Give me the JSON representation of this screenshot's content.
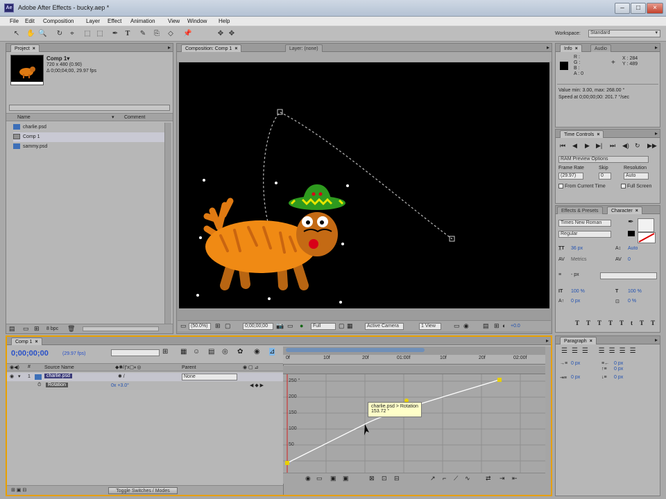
{
  "app": {
    "window_title": "Adobe After Effects - bucky.aep *",
    "icon_label": "Ae"
  },
  "window_controls": {
    "minimize": "–",
    "maximize": "□",
    "close": "×"
  },
  "menu": [
    "File",
    "Edit",
    "Composition",
    "Layer",
    "Effect",
    "Animation",
    "View",
    "Window",
    "Help"
  ],
  "toolbar": {
    "tools": [
      "↖",
      "✋",
      "🔍",
      "↻",
      "⌖",
      "⬚",
      "✒",
      "T",
      "✎",
      "⎘",
      "◇",
      "📌",
      "✥"
    ],
    "workspace_label": "Workspace:",
    "workspace_value": "Standard"
  },
  "project": {
    "tab": "Project",
    "comp_name": "Comp 1▾",
    "comp_size": "720 x 480 (0.90)",
    "comp_duration": "Δ 0;00;04;00, 29.97 fps",
    "col_name": "Name",
    "col_comment": "Comment",
    "items": [
      {
        "name": "charlie.psd",
        "type": "psd"
      },
      {
        "name": "Comp 1",
        "type": "comp"
      },
      {
        "name": "sammy.psd",
        "type": "psd"
      }
    ],
    "bpc": "8 bpc"
  },
  "composition_panel": {
    "tab1": "Composition: Comp 1",
    "tab2": "Layer: (none)",
    "zoom": "(50.0%)",
    "time": "0;00;00;00",
    "resolution": "Full",
    "camera": "Active Camera",
    "views": "1 View",
    "exposure": "+0.0"
  },
  "info_panel": {
    "tab_info": "Info",
    "tab_audio": "Audio",
    "r": "R :",
    "g": "G :",
    "b": "B :",
    "a": "A : 0",
    "x": "X : 284",
    "y": "Y : 489",
    "value_line": "Value min: 3.00, max: 268.00 °",
    "speed_line": "Speed at 0;00;00;00: 201.7 °/sec"
  },
  "time_controls": {
    "tab": "Time Controls",
    "preview_option": "RAM Preview Options",
    "frame_rate_label": "Frame Rate",
    "skip_label": "Skip",
    "resolution_label": "Resolution",
    "frame_rate_value": "(29.97)",
    "skip_value": "0",
    "resolution_value": "Auto",
    "from_current": "From Current Time",
    "full_screen": "Full Screen"
  },
  "character_panel": {
    "tab_effects": "Effects & Presets",
    "tab_character": "Character",
    "font": "Times New Roman",
    "style": "Regular",
    "size": "36 px",
    "leading": "Auto",
    "kerning": "Metrics",
    "tracking": "0",
    "stroke_width": "- px",
    "vscale": "100 %",
    "hscale": "100 %",
    "baseline": "0 px",
    "tsume": "0 %",
    "styles": [
      "T",
      "T",
      "TT",
      "Tt",
      "T",
      "T"
    ]
  },
  "paragraph_panel": {
    "tab": "Paragraph",
    "indent_left": "0 px",
    "indent_right": "0 px",
    "space_before": "0 px",
    "indent_first": "0 px",
    "space_after": "0 px"
  },
  "timeline": {
    "tab": "Comp 1",
    "current_time": "0;00;00;00",
    "fps": "(29.97 fps)",
    "col_source": "Source Name",
    "col_parent": "Parent",
    "layer_num": "1",
    "layer_name": "charlie.psd",
    "parent_value": "None",
    "property": "Rotation",
    "property_value": "0x +3.0°",
    "ruler_labels": [
      "0f",
      "10f",
      "20f",
      "01:00f",
      "10f",
      "20f",
      "02:00f"
    ],
    "graph_values": [
      "250 °",
      "200",
      "150",
      "100",
      "50"
    ],
    "tooltip_line1": "charlie.psd > Rotation",
    "tooltip_line2": "153.72 °",
    "toggle": "Toggle Switches / Modes"
  },
  "colors": {
    "viewer_bg": "#000000",
    "timeline_accent": "#e8a000",
    "time_blue": "#2850c8",
    "graph_line": "#ffffff"
  }
}
